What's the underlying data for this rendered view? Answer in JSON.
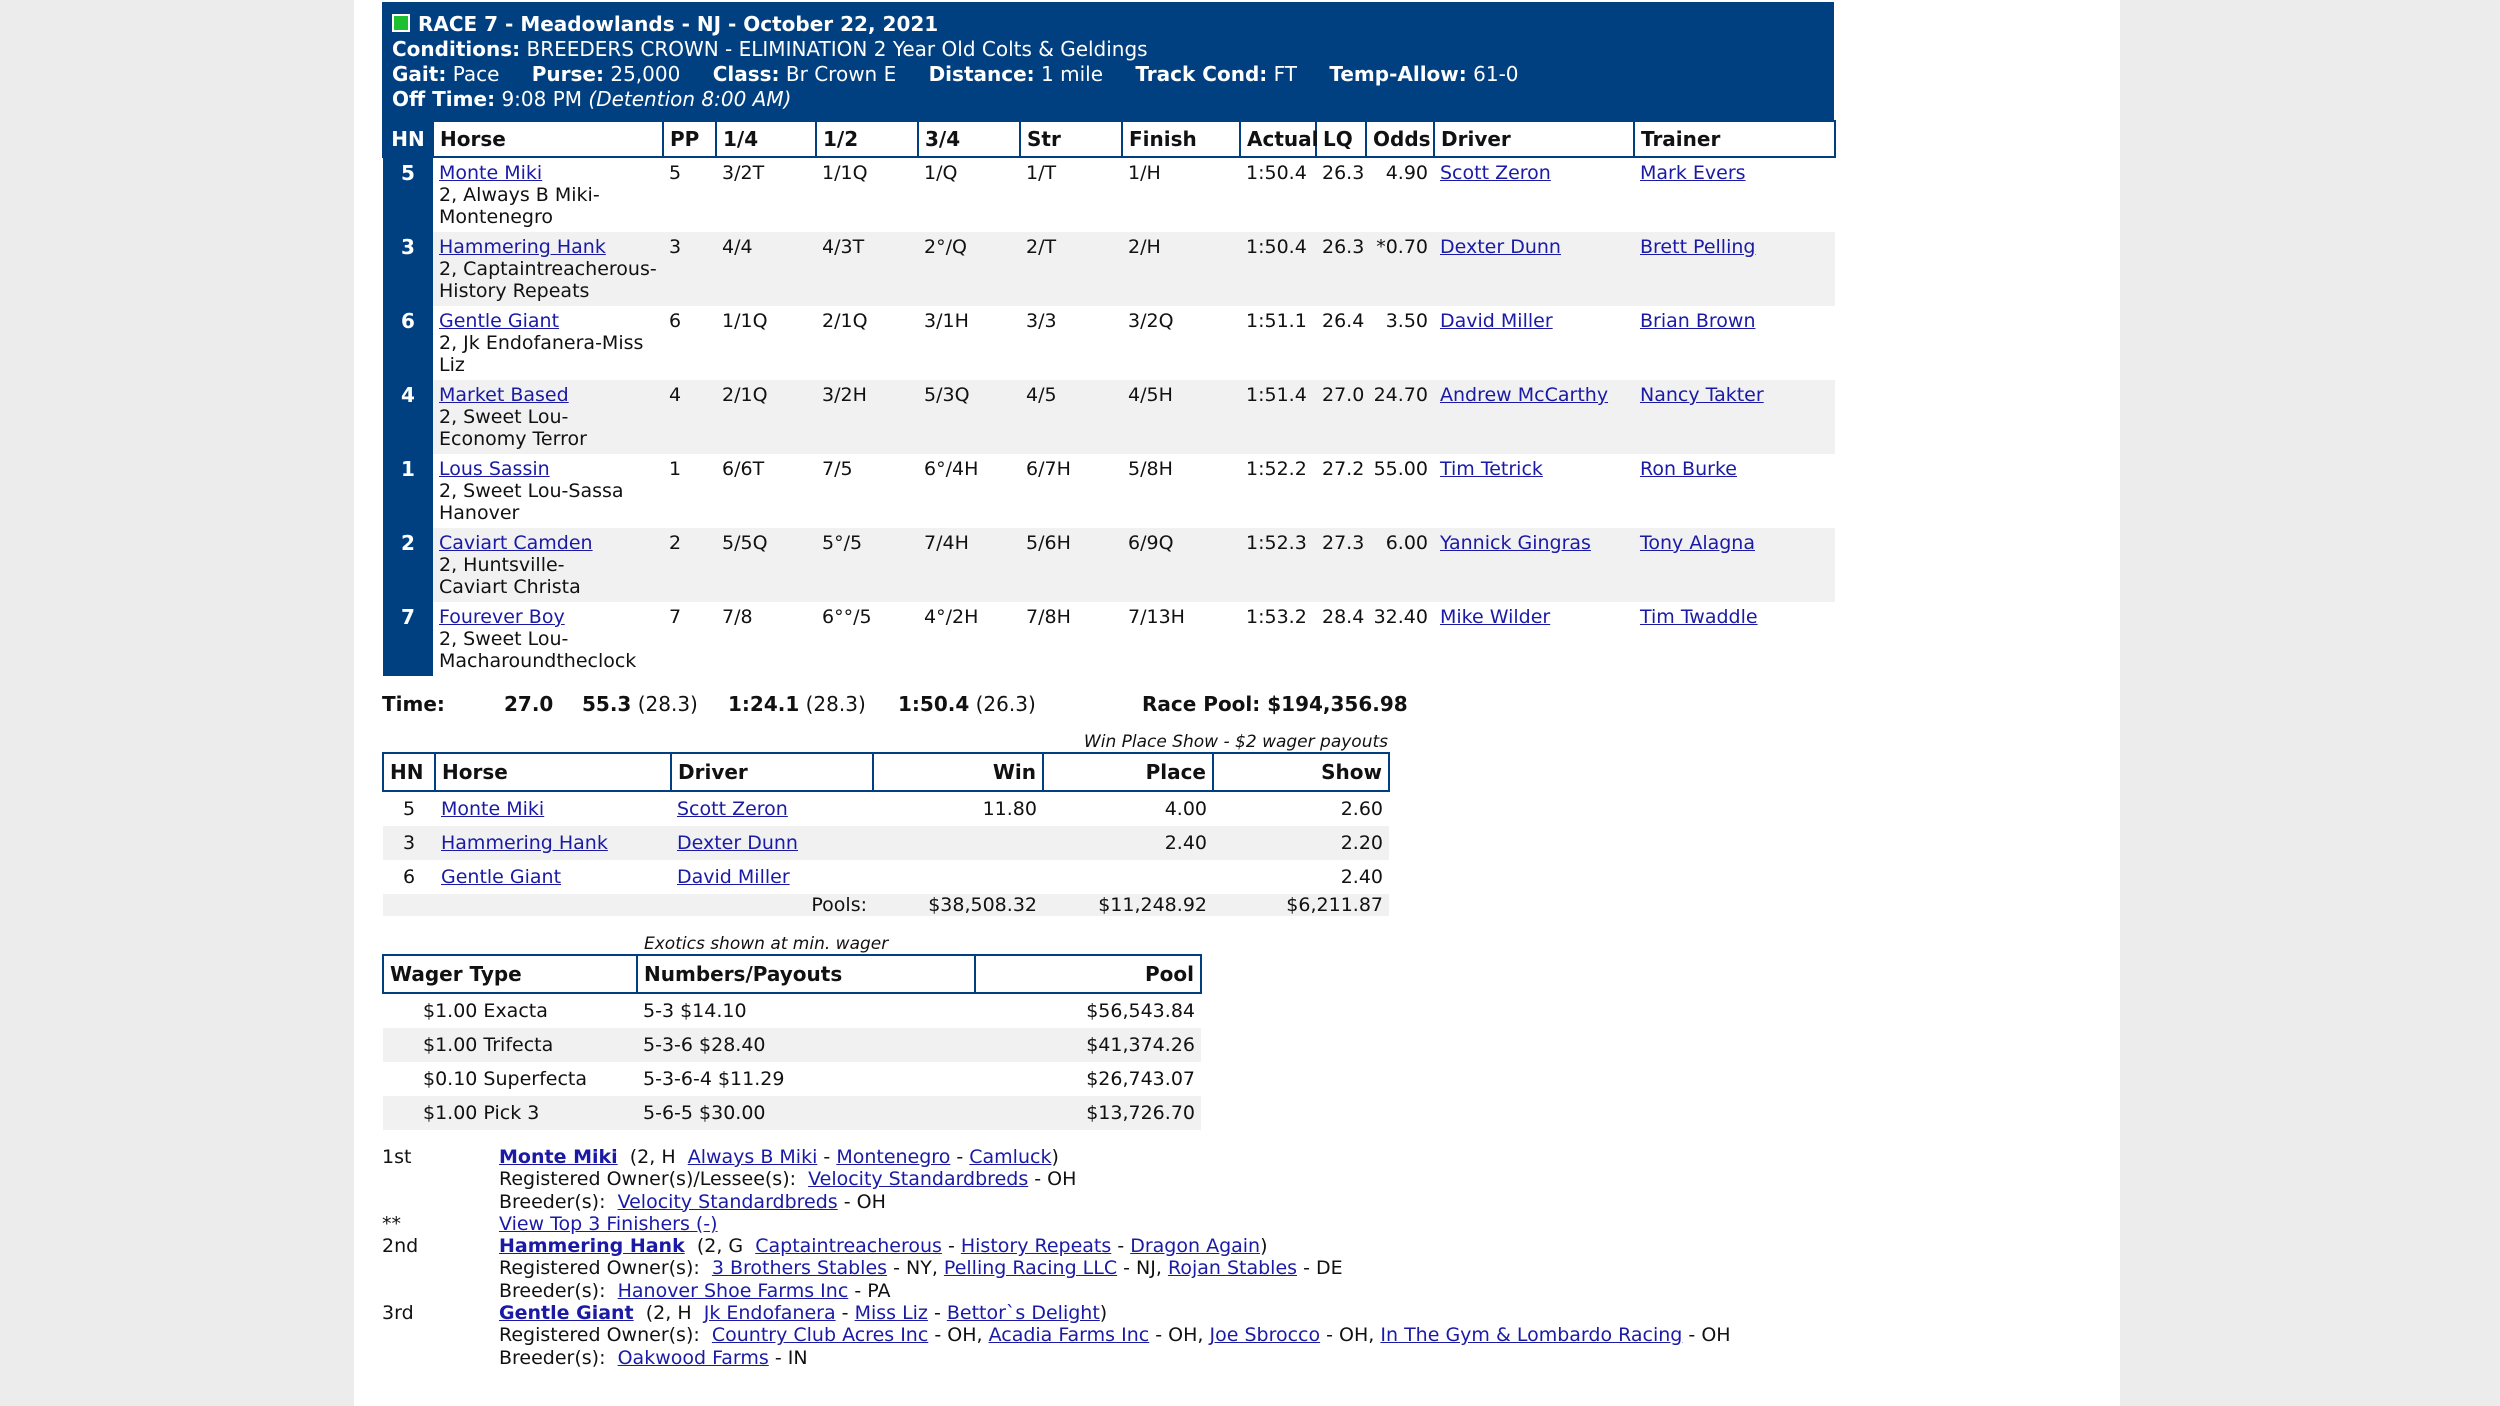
{
  "race": {
    "title": "RACE 7 - Meadowlands - NJ - October 22, 2021",
    "conditions_label": "Conditions:",
    "conditions": "BREEDERS CROWN - ELIMINATION 2 Year Old Colts & Geldings",
    "gait_label": "Gait:",
    "gait": "Pace",
    "purse_label": "Purse:",
    "purse": "25,000",
    "class_label": "Class:",
    "class": "Br Crown E",
    "distance_label": "Distance:",
    "distance": "1 mile",
    "track_label": "Track Cond:",
    "track": "FT",
    "temp_label": "Temp-Allow:",
    "temp": "61-0",
    "off_label": "Off Time:",
    "off_time": "9:08 PM",
    "detention": "(Detention 8:00 AM)"
  },
  "results": {
    "headers": {
      "hn": "HN",
      "horse": "Horse",
      "pp": "PP",
      "q1": "1/4",
      "q2": "1/2",
      "q3": "3/4",
      "str": "Str",
      "finish": "Finish",
      "actual": "Actual",
      "lq": "LQ",
      "odds": "Odds",
      "driver": "Driver",
      "trainer": "Trainer"
    },
    "rows": [
      {
        "hn": "5",
        "horse": "Monte Miki",
        "breeding1": "2, Always B Miki-",
        "breeding2": "Montenegro",
        "pp": "5",
        "q1": "3/2T",
        "q2": "1/1Q",
        "q3": "1/Q",
        "str": "1/T",
        "finish": "1/H",
        "actual": "1:50.4",
        "lq": "26.3",
        "odds": "4.90",
        "driver": "Scott Zeron",
        "trainer": "Mark Evers"
      },
      {
        "hn": "3",
        "horse": "Hammering Hank",
        "breeding1": "2, Captaintreacherous-",
        "breeding2": "History Repeats",
        "pp": "3",
        "q1": "4/4",
        "q2": "4/3T",
        "q3": "2°/Q",
        "str": "2/T",
        "finish": "2/H",
        "actual": "1:50.4",
        "lq": "26.3",
        "odds": "*0.70",
        "driver": "Dexter Dunn",
        "trainer": "Brett Pelling"
      },
      {
        "hn": "6",
        "horse": "Gentle Giant",
        "breeding1": "2, Jk Endofanera-Miss",
        "breeding2": "Liz",
        "pp": "6",
        "q1": "1/1Q",
        "q2": "2/1Q",
        "q3": "3/1H",
        "str": "3/3",
        "finish": "3/2Q",
        "actual": "1:51.1",
        "lq": "26.4",
        "odds": "3.50",
        "driver": "David Miller",
        "trainer": "Brian Brown"
      },
      {
        "hn": "4",
        "horse": "Market Based",
        "breeding1": "2, Sweet Lou-",
        "breeding2": "Economy Terror",
        "pp": "4",
        "q1": "2/1Q",
        "q2": "3/2H",
        "q3": "5/3Q",
        "str": "4/5",
        "finish": "4/5H",
        "actual": "1:51.4",
        "lq": "27.0",
        "odds": "24.70",
        "driver": "Andrew McCarthy",
        "trainer": "Nancy Takter"
      },
      {
        "hn": "1",
        "horse": "Lous Sassin",
        "breeding1": "2, Sweet Lou-Sassa",
        "breeding2": "Hanover",
        "pp": "1",
        "q1": "6/6T",
        "q2": "7/5",
        "q3": "6°/4H",
        "str": "6/7H",
        "finish": "5/8H",
        "actual": "1:52.2",
        "lq": "27.2",
        "odds": "55.00",
        "driver": "Tim Tetrick",
        "trainer": "Ron Burke"
      },
      {
        "hn": "2",
        "horse": "Caviart Camden",
        "breeding1": "2, Huntsville-",
        "breeding2": "Caviart Christa",
        "pp": "2",
        "q1": "5/5Q",
        "q2": "5°/5",
        "q3": "7/4H",
        "str": "5/6H",
        "finish": "6/9Q",
        "actual": "1:52.3",
        "lq": "27.3",
        "odds": "6.00",
        "driver": "Yannick Gingras",
        "trainer": "Tony Alagna"
      },
      {
        "hn": "7",
        "horse": "Fourever Boy",
        "breeding1": "2, Sweet Lou-",
        "breeding2": "Macharoundtheclock",
        "pp": "7",
        "q1": "7/8",
        "q2": "6°°/5",
        "q3": "4°/2H",
        "str": "7/8H",
        "finish": "7/13H",
        "actual": "1:53.2",
        "lq": "28.4",
        "odds": "32.40",
        "driver": "Mike Wilder",
        "trainer": "Tim Twaddle"
      }
    ]
  },
  "times": {
    "label": "Time:",
    "q1": "27.0",
    "q2": "55.3",
    "q2_split": "(28.3)",
    "q3": "1:24.1",
    "q3_split": "(28.3)",
    "final": "1:50.4",
    "final_split": "(26.3)",
    "pool": "Race Pool: $194,356.98"
  },
  "wps": {
    "caption": "Win Place Show - $2 wager payouts",
    "headers": {
      "hn": "HN",
      "horse": "Horse",
      "driver": "Driver",
      "win": "Win",
      "place": "Place",
      "show": "Show"
    },
    "rows": [
      {
        "hn": "5",
        "horse": "Monte Miki",
        "driver": "Scott Zeron",
        "win": "11.80",
        "place": "4.00",
        "show": "2.60"
      },
      {
        "hn": "3",
        "horse": "Hammering Hank",
        "driver": "Dexter Dunn",
        "win": "",
        "place": "2.40",
        "show": "2.20"
      },
      {
        "hn": "6",
        "horse": "Gentle Giant",
        "driver": "David Miller",
        "win": "",
        "place": "",
        "show": "2.40"
      }
    ],
    "pools_label": "Pools:",
    "pool_win": "$38,508.32",
    "pool_place": "$11,248.92",
    "pool_show": "$6,211.87"
  },
  "exotics": {
    "caption": "Exotics shown at min. wager",
    "headers": {
      "type": "Wager Type",
      "numbers": "Numbers/Payouts",
      "pool": "Pool"
    },
    "rows": [
      {
        "type": "$1.00 Exacta",
        "numbers": "5-3 $14.10",
        "pool": "$56,543.84"
      },
      {
        "type": "$1.00 Trifecta",
        "numbers": "5-3-6 $28.40",
        "pool": "$41,374.26"
      },
      {
        "type": "$0.10 Superfecta",
        "numbers": "5-3-6-4 $11.29",
        "pool": "$26,743.07"
      },
      {
        "type": "$1.00 Pick 3",
        "numbers": "5-6-5 $30.00",
        "pool": "$13,726.70"
      }
    ]
  },
  "finishers": {
    "first": {
      "place": "1st",
      "name": "Monte Miki",
      "info": "(2, H",
      "sire": "Always B Miki",
      "dam": "Montenegro",
      "damsire": "Camluck",
      "owner_label": "Registered Owner(s)/Lessee(s):",
      "owner1": "Velocity Standardbreds",
      "owner1_state": "- OH",
      "breeder_label": "Breeder(s):",
      "breeder": "Velocity Standardbreds",
      "breeder_state": "- OH"
    },
    "top3": {
      "marker": "**",
      "link": "View Top 3 Finishers (-)"
    },
    "second": {
      "place": "2nd",
      "name": "Hammering Hank",
      "info": "(2, G",
      "sire": "Captaintreacherous",
      "dam": "History Repeats",
      "damsire": "Dragon Again",
      "owner_label": "Registered Owner(s):",
      "owner1": "3 Brothers Stables",
      "owner1_state": "- NY,",
      "owner2": "Pelling Racing LLC",
      "owner2_state": "- NJ,",
      "owner3": "Rojan Stables",
      "owner3_state": "- DE",
      "breeder_label": "Breeder(s):",
      "breeder": "Hanover Shoe Farms Inc",
      "breeder_state": "- PA"
    },
    "third": {
      "place": "3rd",
      "name": "Gentle Giant",
      "info": "(2, H",
      "sire": "Jk Endofanera",
      "dam": "Miss Liz",
      "damsire": "Bettor`s Delight",
      "owner_label": "Registered Owner(s):",
      "owner1": "Country Club Acres Inc",
      "owner1_state": "- OH,",
      "owner2": "Acadia Farms Inc",
      "owner2_state": "- OH,",
      "owner3": "Joe Sbrocco",
      "owner3_state": "- OH,",
      "owner4": "In The Gym & Lombardo Racing",
      "owner4_state": "- OH",
      "breeder_label": "Breeder(s):",
      "breeder": "Oakwood Farms",
      "breeder_state": "- IN"
    }
  },
  "colors": {
    "header_blue": "#004080",
    "status_green": "#1fbf32",
    "link": "#1a1aa6",
    "row_alt": "#f1f1f1",
    "page_bg": "#ececec"
  }
}
